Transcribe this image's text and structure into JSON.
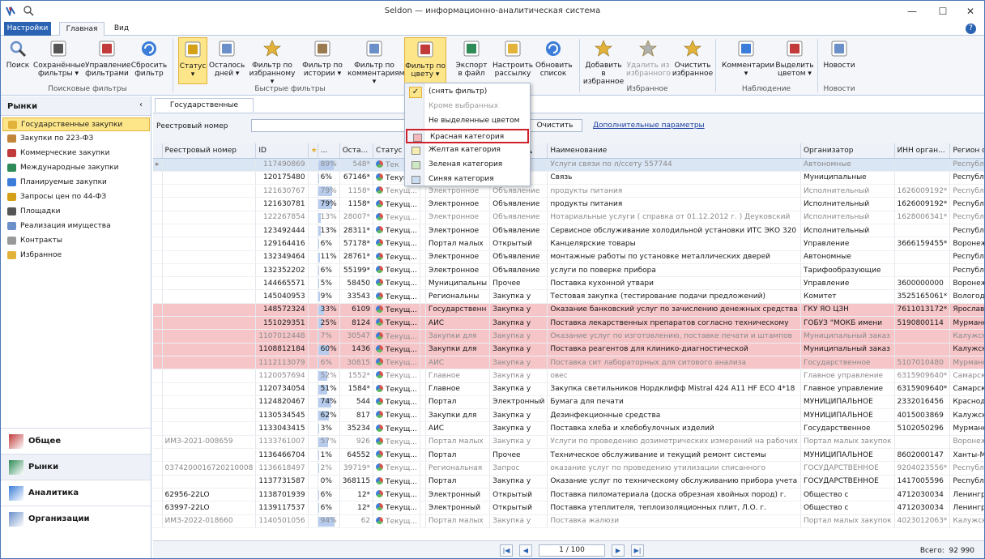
{
  "window": {
    "title": "Seldon — информационно-аналитическая система"
  },
  "ribbon_tabs": [
    "Настройки",
    "Главная",
    "Вид"
  ],
  "ribbon": {
    "buttons": [
      {
        "label": "Поиск",
        "icon": "magnifier-icon"
      },
      {
        "label": "Сохранённые фильтры ▾",
        "icon": "floppy-disk-icon"
      },
      {
        "label": "Управление фильтрами",
        "icon": "filter-manage-icon"
      },
      {
        "label": "Сбросить фильтр",
        "icon": "reset-filter-icon"
      },
      {
        "label": "Статус ▾",
        "icon": "status-clipboard-icon"
      },
      {
        "label": "Осталось дней ▾",
        "icon": "calendar-icon"
      },
      {
        "label": "Фильтр по избранному ▾",
        "icon": "favorite-filter-icon"
      },
      {
        "label": "Фильтр по истории ▾",
        "icon": "hourglass-icon"
      },
      {
        "label": "Фильтр по комментариям ▾",
        "icon": "comment-filter-icon"
      },
      {
        "label": "Фильтр по цвету ▾",
        "icon": "color-filter-icon"
      },
      {
        "label": "Экспорт в файл",
        "icon": "excel-export-icon"
      },
      {
        "label": "Настроить рассылку",
        "icon": "envelope-icon"
      },
      {
        "label": "Обновить список",
        "icon": "refresh-icon"
      },
      {
        "label": "Добавить в избранное",
        "icon": "star-add-icon"
      },
      {
        "label": "Удалить из избранного",
        "icon": "star-remove-icon"
      },
      {
        "label": "Очистить избранное",
        "icon": "star-clear-icon"
      },
      {
        "label": "Комментарии ▾",
        "icon": "comments-icon"
      },
      {
        "label": "Выделить цветом ▾",
        "icon": "palette-icon"
      },
      {
        "label": "Новости",
        "icon": "news-icon"
      }
    ],
    "groups": [
      "Поисковые фильтры",
      "Быстрые фильтры",
      "Избранное",
      "Наблюдение",
      "Новости"
    ]
  },
  "sidebar": {
    "header": "Рынки",
    "items": [
      "Государственные закупки",
      "Закупки по 223-ФЗ",
      "Коммерческие закупки",
      "Международные закупки",
      "Планируемые закупки",
      "Запросы цен по 44-ФЗ",
      "Площадки",
      "Реализация имущества",
      "Контракты",
      "Избранное"
    ],
    "nav_groups": [
      "Общее",
      "Рынки",
      "Аналитика",
      "Организации"
    ]
  },
  "doc_tab": "Государственные закупки",
  "filter": {
    "label": "Реестровый номер",
    "value": "",
    "clear_button": "Очистить",
    "advanced_link": "Дополнительные параметры"
  },
  "grid": {
    "columns": [
      "Реестровый номер",
      "ID",
      "★",
      "...",
      "Оста...",
      "Статус",
      "",
      "",
      "Тип за... ▲",
      "Наименование",
      "Организатор",
      "ИНН орган...",
      "Регион орган"
    ],
    "rows": [
      {
        "kind": "cur gray",
        "reg": "",
        "id": "117490869",
        "pct": 89,
        "ost": "548*",
        "st": "Тек",
        "sp": "",
        "vid": "",
        "tip": "",
        "name": "Услуги связи по л/ссету 557744",
        "org": "Автономные",
        "inn": "",
        "reg2": "Республика Т"
      },
      {
        "kind": "",
        "reg": "",
        "id": "120175480",
        "pct": 6,
        "ost": "67146*",
        "st": "Текущ...",
        "sp": "",
        "vid": "",
        "tip": "",
        "name": "Связь",
        "org": "Муниципальные",
        "inn": "",
        "reg2": "Республика Т"
      },
      {
        "kind": "gray",
        "reg": "",
        "id": "121630767",
        "pct": 79,
        "ost": "1158*",
        "st": "Текущ...",
        "sp": "Электронное",
        "vid": "Объявление",
        "tip": "",
        "name": "продукты питания",
        "org": "Исполнительный",
        "inn": "1626009192*",
        "reg2": "Республика Т"
      },
      {
        "kind": "",
        "reg": "",
        "id": "121630781",
        "pct": 79,
        "ost": "1158*",
        "st": "Текущ...",
        "sp": "Электронное",
        "vid": "Объявление",
        "tip": "",
        "name": "продукты питания",
        "org": "Исполнительный",
        "inn": "1626009192*",
        "reg2": "Республика Т"
      },
      {
        "kind": "gray",
        "reg": "",
        "id": "122267854",
        "pct": 13,
        "ost": "28007*",
        "st": "Текущ...",
        "sp": "Электронное",
        "vid": "Объявление",
        "tip": "",
        "name": "Нотариальные услуги ( справка от 01.12.2012 г. ) Деуковский",
        "org": "Исполнительный",
        "inn": "1628006341*",
        "reg2": "Республика Т"
      },
      {
        "kind": "",
        "reg": "",
        "id": "123492444",
        "pct": 13,
        "ost": "28311*",
        "st": "Текущ...",
        "sp": "Электронное",
        "vid": "Объявление",
        "tip": "",
        "name": "Сервисное обслуживание холодильной установки ИТС ЭКО 320",
        "org": "Исполнительный",
        "inn": "",
        "reg2": "Республика Т"
      },
      {
        "kind": "",
        "reg": "",
        "id": "129164416",
        "pct": 6,
        "ost": "57178*",
        "st": "Текущ...",
        "sp": "Портал малых",
        "vid": "Открытый",
        "tip": "",
        "name": "Канцелярские товары",
        "org": "Управление",
        "inn": "3666159455*",
        "reg2": "Воронежская"
      },
      {
        "kind": "",
        "reg": "",
        "id": "132349464",
        "pct": 11,
        "ost": "28761*",
        "st": "Текущ...",
        "sp": "Электронное",
        "vid": "Объявление",
        "tip": "",
        "name": "монтажные работы по установке металлических дверей",
        "org": "Автономные",
        "inn": "",
        "reg2": "Республика Т"
      },
      {
        "kind": "",
        "reg": "",
        "id": "132352202",
        "pct": 6,
        "ost": "55199*",
        "st": "Текущ...",
        "sp": "Электронное",
        "vid": "Объявление",
        "tip": "",
        "name": "услуги по поверке прибора",
        "org": "Тарифообразующие",
        "inn": "",
        "reg2": "Республика Т"
      },
      {
        "kind": "",
        "reg": "",
        "id": "144665571",
        "pct": 5,
        "ost": "58450",
        "st": "Текущ...",
        "sp": "Муниципальны",
        "vid": "Прочее",
        "tip": "",
        "name": "Поставка кухонной утвари",
        "org": "Управление",
        "inn": "3600000000",
        "reg2": "Воронежская"
      },
      {
        "kind": "",
        "reg": "",
        "id": "145040953",
        "pct": 9,
        "ost": "33543",
        "st": "Текущ...",
        "sp": "Региональны",
        "vid": "Закупка у",
        "tip": "",
        "name": "Тестовая закупка (тестирование подачи предложений)",
        "org": "Комитет",
        "inn": "3525165061*",
        "reg2": "Вологодская"
      },
      {
        "kind": "red",
        "reg": "",
        "id": "148572324",
        "pct": 33,
        "ost": "6109",
        "st": "Текущ...",
        "sp": "Государственн",
        "vid": "Закупка у",
        "tip": "",
        "name": "Оказание банковский услуг по зачислению денежных средства",
        "org": "ГКУ ЯО ЦЗН",
        "inn": "7611013172*",
        "reg2": "Ярославская"
      },
      {
        "kind": "red",
        "reg": "",
        "id": "151029351",
        "pct": 25,
        "ost": "8124",
        "st": "Текущ...",
        "sp": "АИС",
        "vid": "Закупка у",
        "tip": "",
        "name": "Поставка лекарственных препаратов согласно техническому",
        "org": "ГОБУЗ \"МОКБ имени",
        "inn": "5190800114",
        "reg2": "Мурманская"
      },
      {
        "kind": "red gray",
        "reg": "",
        "id": "1107012448",
        "pct": 7,
        "ost": "30547",
        "st": "Текущ...",
        "sp": "Закупки для",
        "vid": "Закупка у",
        "tip": "",
        "name": "Оказание услуг по изготовлению, поставке печати и штампов",
        "org": "Муниципальный заказ",
        "inn": "",
        "reg2": "Калужская о"
      },
      {
        "kind": "red",
        "reg": "",
        "id": "1108812184",
        "pct": 60,
        "ost": "1436",
        "st": "Текущ...",
        "sp": "Закупки для",
        "vid": "Закупка у",
        "tip": "",
        "name": "Поставка реагентов для клинико-диагностической",
        "org": "Муниципальный заказ",
        "inn": "",
        "reg2": "Калужская о"
      },
      {
        "kind": "red gray",
        "reg": "",
        "id": "1112113079",
        "pct": 6,
        "ost": "30815",
        "st": "Текущ...",
        "sp": "АИС",
        "vid": "Закупка у",
        "tip": "",
        "name": "Поставка сит лабораторных для ситового анализа",
        "org": "Государственное",
        "inn": "5107010480",
        "reg2": "Мурманская"
      },
      {
        "kind": "gray",
        "reg": "",
        "id": "1120057694",
        "pct": 52,
        "ost": "1552*",
        "st": "Текущ...",
        "sp": "Главное",
        "vid": "Закупка у",
        "tip": "",
        "name": "овес",
        "org": "Главное управление",
        "inn": "6315909640*",
        "reg2": "Самарская о"
      },
      {
        "kind": "",
        "reg": "",
        "id": "1120734054",
        "pct": 51,
        "ost": "1584*",
        "st": "Текущ...",
        "sp": "Главное",
        "vid": "Закупка у",
        "tip": "",
        "name": "Закупка светильников Нордклифф Mistral 424 A11 HF ECO 4*18",
        "org": "Главное управление",
        "inn": "6315909640*",
        "reg2": "Самарская о"
      },
      {
        "kind": "",
        "reg": "",
        "id": "1124820467",
        "pct": 74,
        "ost": "544",
        "st": "Текущ...",
        "sp": "Портал",
        "vid": "Электронный",
        "tip": "",
        "name": "Бумага для печати",
        "org": "МУНИЦИПАЛЬНОЕ",
        "inn": "2332016456",
        "reg2": "Краснодарс"
      },
      {
        "kind": "",
        "reg": "",
        "id": "1130534545",
        "pct": 62,
        "ost": "817",
        "st": "Текущ...",
        "sp": "Закупки для",
        "vid": "Закупка у",
        "tip": "",
        "name": "Дезинфекционные средства",
        "org": "МУНИЦИПАЛЬНОЕ",
        "inn": "4015003869",
        "reg2": "Калужская о"
      },
      {
        "kind": "",
        "reg": "",
        "id": "1133043415",
        "pct": 3,
        "ost": "35234",
        "st": "Текущ...",
        "sp": "АИС",
        "vid": "Закупка у",
        "tip": "",
        "name": "Поставка хлеба и хлебобулочных изделий",
        "org": "Государственное",
        "inn": "5102050296",
        "reg2": "Мурманская"
      },
      {
        "kind": "gray",
        "reg": "ИМЗ-2021-008659",
        "id": "1133761007",
        "pct": 57,
        "ost": "926",
        "st": "Текущ...",
        "sp": "Портал малых",
        "vid": "Закупка у",
        "tip": "",
        "name": "Услуги по проведению дозиметрических измерений на рабочих",
        "org": "Портал малых закупок",
        "inn": "",
        "reg2": "Воронежская"
      },
      {
        "kind": "",
        "reg": "",
        "id": "1136466704",
        "pct": 1,
        "ost": "64552",
        "st": "Текущ...",
        "sp": "Портал",
        "vid": "Прочее",
        "tip": "",
        "name": "Техническое обслуживание и текущий ремонт системы",
        "org": "МУНИЦИПАЛЬНОЕ",
        "inn": "8602000147",
        "reg2": "Ханты-Манси"
      },
      {
        "kind": "gray",
        "reg": "0374200016720210008",
        "id": "1136618497",
        "pct": 2,
        "ost": "39719*",
        "st": "Текущ...",
        "sp": "Региональная",
        "vid": "Запрос",
        "tip": "",
        "name": "оказание услуг по проведению утилизации списанного",
        "org": "ГОСУДАРСТВЕННОЕ",
        "inn": "9204023556*",
        "reg2": "Республика"
      },
      {
        "kind": "",
        "reg": "",
        "id": "1137731587",
        "pct": 0,
        "ost": "368115",
        "st": "Текущ...",
        "sp": "Портал",
        "vid": "Закупка у",
        "tip": "",
        "name": "Оказание услуг по техническому обслуживанию прибора учета",
        "org": "ГОСУДАРСТВЕННОЕ",
        "inn": "1417005596",
        "reg2": "Республика С"
      },
      {
        "kind": "",
        "reg": "62956-22LO",
        "id": "1138701939",
        "pct": 6,
        "ost": "12*",
        "st": "Текущ...",
        "sp": "Электронный",
        "vid": "Открытый",
        "tip": "",
        "name": "Поставка пиломатериала (доска обрезная хвойных пород) г.",
        "org": "Общество с",
        "inn": "4712030034",
        "reg2": "Ленинградс"
      },
      {
        "kind": "",
        "reg": "63997-22LO",
        "id": "1139117537",
        "pct": 6,
        "ost": "12*",
        "st": "Текущ...",
        "sp": "Электронный",
        "vid": "Открытый",
        "tip": "",
        "name": "Поставка утеплителя, теплоизоляционных плит, Л.О. г.",
        "org": "Общество с",
        "inn": "4712030034",
        "reg2": "Ленинградс"
      },
      {
        "kind": "gray",
        "reg": "ИМЗ-2022-018660",
        "id": "1140501056",
        "pct": 94,
        "ost": "62",
        "st": "Текущ...",
        "sp": "Портал малых",
        "vid": "Закупка у",
        "tip": "",
        "name": "Поставка жалюзи",
        "org": "Портал малых закупок",
        "inn": "4023012063*",
        "reg2": "Калужская о"
      }
    ]
  },
  "pager": {
    "page": "1 / 100",
    "total_label": "Всего:",
    "total": "92 990"
  },
  "color_menu": {
    "items": [
      {
        "label": "(снять фильтр)",
        "checked": true,
        "swatch": ""
      },
      {
        "label": "Кроме выбранных",
        "disabled": true,
        "swatch": ""
      },
      {
        "label": "Не выделенные цветом",
        "swatch": ""
      },
      {
        "label": "Красная категория",
        "swatch": "#f3b8bc",
        "selected": true
      },
      {
        "label": "Желтая категория",
        "swatch": "#f5ecb0"
      },
      {
        "label": "Зеленая категория",
        "swatch": "#cfe8c4"
      },
      {
        "label": "Синяя категория",
        "swatch": "#c9dcf2"
      }
    ]
  },
  "colors": {
    "accent": "#2b63b3",
    "highlight": "#fde68a",
    "red_row": "#f6c5c8",
    "selected_border": "#d0202a"
  }
}
